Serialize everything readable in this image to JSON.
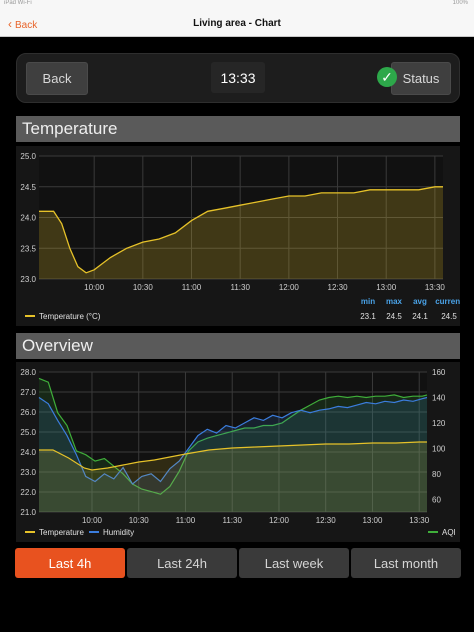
{
  "status_bar": {
    "left": "iPad  Wi-Fi",
    "right": "100%"
  },
  "nav": {
    "back_label": "Back",
    "title": "Living area - Chart"
  },
  "toolbar": {
    "back_label": "Back",
    "time": "13:33",
    "status_label": "Status"
  },
  "temperature": {
    "header": "Temperature",
    "stats_headers": [
      "min",
      "max",
      "avg",
      "current"
    ],
    "stats_values": [
      "23.1",
      "24.5",
      "24.1",
      "24.5"
    ]
  },
  "overview": {
    "header": "Overview"
  },
  "tabs": [
    {
      "label": "Last 4h",
      "active": true
    },
    {
      "label": "Last 24h",
      "active": false
    },
    {
      "label": "Last week",
      "active": false
    },
    {
      "label": "Last month",
      "active": false
    }
  ],
  "colors": {
    "accent": "#e8521f",
    "temperature": "#e6c229",
    "humidity": "#3b7ddd",
    "aqi": "#3fae3a",
    "status_ok": "#2da84a"
  },
  "chart_data": [
    {
      "type": "line",
      "series": [
        {
          "name": "Temperature (°C)",
          "x": [
            "09:26",
            "09:30",
            "09:35",
            "09:40",
            "09:45",
            "09:50",
            "09:55",
            "10:00",
            "10:05",
            "10:10",
            "10:20",
            "10:30",
            "10:40",
            "10:50",
            "11:00",
            "11:10",
            "11:20",
            "11:30",
            "11:40",
            "11:50",
            "12:00",
            "12:10",
            "12:20",
            "12:30",
            "12:40",
            "12:50",
            "13:00",
            "13:10",
            "13:20",
            "13:30",
            "13:35"
          ],
          "y": [
            24.1,
            24.1,
            24.1,
            23.9,
            23.5,
            23.2,
            23.1,
            23.15,
            23.25,
            23.35,
            23.5,
            23.6,
            23.65,
            23.75,
            23.95,
            24.1,
            24.15,
            24.2,
            24.25,
            24.3,
            24.35,
            24.35,
            24.4,
            24.4,
            24.4,
            24.45,
            24.45,
            24.45,
            24.45,
            24.5,
            24.5
          ]
        }
      ],
      "ylim": [
        23.0,
        25.0
      ],
      "yticks": [
        "25.0",
        "24.5",
        "24.0",
        "23.5",
        "23.0"
      ],
      "xticks": [
        "10:00",
        "10:30",
        "11:00",
        "11:30",
        "12:00",
        "12:30",
        "13:00",
        "13:30"
      ],
      "legend": "bottom-left",
      "grid": true
    },
    {
      "type": "line",
      "series": [
        {
          "name": "Temperature",
          "axis": "left",
          "x": [
            "09:26",
            "09:35",
            "09:45",
            "09:55",
            "10:00",
            "10:10",
            "10:20",
            "10:30",
            "10:40",
            "10:50",
            "11:00",
            "11:15",
            "11:30",
            "11:45",
            "12:00",
            "12:15",
            "12:30",
            "12:45",
            "13:00",
            "13:15",
            "13:30",
            "13:35"
          ],
          "y": [
            24.1,
            24.1,
            23.7,
            23.2,
            23.1,
            23.2,
            23.35,
            23.5,
            23.6,
            23.75,
            23.9,
            24.1,
            24.2,
            24.25,
            24.3,
            24.35,
            24.4,
            24.4,
            24.45,
            24.45,
            24.5,
            24.5
          ]
        },
        {
          "name": "Humidity",
          "axis": "right",
          "x": [
            "09:26",
            "09:32",
            "09:38",
            "09:44",
            "09:50",
            "09:56",
            "10:02",
            "10:08",
            "10:14",
            "10:20",
            "10:26",
            "10:32",
            "10:38",
            "10:44",
            "10:50",
            "10:56",
            "11:02",
            "11:08",
            "11:14",
            "11:20",
            "11:26",
            "11:32",
            "11:38",
            "11:44",
            "11:50",
            "11:56",
            "12:02",
            "12:08",
            "12:14",
            "12:20",
            "12:26",
            "12:32",
            "12:38",
            "12:44",
            "12:50",
            "12:56",
            "13:02",
            "13:08",
            "13:14",
            "13:20",
            "13:26",
            "13:32",
            "13:35"
          ],
          "y": [
            140,
            135,
            122,
            110,
            95,
            78,
            74,
            80,
            76,
            85,
            72,
            78,
            80,
            74,
            84,
            90,
            100,
            110,
            115,
            112,
            118,
            116,
            120,
            124,
            122,
            126,
            124,
            128,
            130,
            128,
            130,
            131,
            133,
            132,
            134,
            136,
            135,
            137,
            136,
            138,
            137,
            139,
            140
          ]
        },
        {
          "name": "AQI",
          "axis": "right",
          "x": [
            "09:26",
            "09:32",
            "09:38",
            "09:44",
            "09:50",
            "09:56",
            "10:02",
            "10:08",
            "10:14",
            "10:20",
            "10:26",
            "10:32",
            "10:38",
            "10:44",
            "10:50",
            "10:56",
            "11:02",
            "11:08",
            "11:14",
            "11:20",
            "11:26",
            "11:32",
            "11:38",
            "11:44",
            "11:50",
            "11:56",
            "12:02",
            "12:08",
            "12:14",
            "12:20",
            "12:26",
            "12:32",
            "12:38",
            "12:44",
            "12:50",
            "12:56",
            "13:02",
            "13:08",
            "13:14",
            "13:20",
            "13:26",
            "13:32",
            "13:35"
          ],
          "y": [
            155,
            152,
            128,
            118,
            98,
            95,
            90,
            92,
            86,
            80,
            72,
            68,
            66,
            64,
            70,
            82,
            98,
            105,
            108,
            110,
            112,
            114,
            116,
            116,
            118,
            118,
            120,
            125,
            130,
            134,
            138,
            140,
            141,
            140,
            141,
            140,
            141,
            141,
            142,
            140,
            141,
            141,
            142
          ]
        }
      ],
      "ylim": [
        21.0,
        28.0
      ],
      "yticks": [
        "28.0",
        "27.0",
        "26.0",
        "25.0",
        "24.0",
        "23.0",
        "22.0",
        "21.0"
      ],
      "y2lim": [
        50,
        160
      ],
      "y2ticks": [
        "160",
        "140",
        "120",
        "100",
        "80",
        "60"
      ],
      "xticks": [
        "10:00",
        "10:30",
        "11:00",
        "11:30",
        "12:00",
        "12:30",
        "13:00",
        "13:30"
      ],
      "legend": "bottom",
      "grid": true
    }
  ]
}
